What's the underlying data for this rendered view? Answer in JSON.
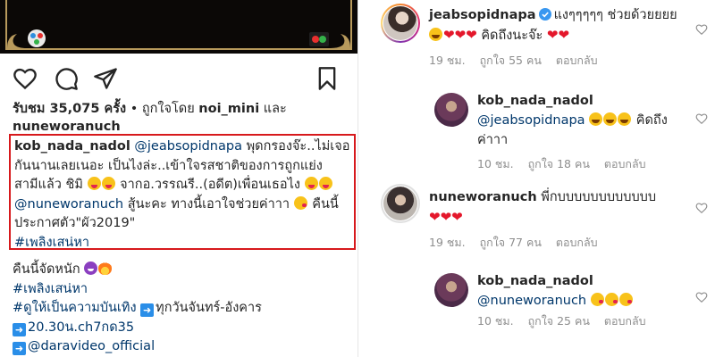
{
  "post": {
    "likes_prefix": "รับชม",
    "views_count": "35,075",
    "views_suffix": "ครั้ง",
    "liked_by_prefix": "• ถูกใจโดย",
    "liked_by_user": "noi_mini",
    "and_word": "และ",
    "liked_by_user2": "nuneworanuch",
    "caption": {
      "username": "kob_nada_nadol",
      "mention1": "@jeabsopidnapa",
      "line1_text": "พุดกรองจ๊ะ..ไม่เจอ",
      "line2": "กันนานเลยเนอะ เป็นไงล่ะ..เข้าใจรสชาติของการถูกแย่ง",
      "line3_text": "สามีแล้ว ชิมิ",
      "line3_after": "จากอ.วรรณรี..(อดีต)เพื่อนเธอไง",
      "mention2": "@nuneworanuch",
      "line4_text": "สู้นะคะ ทางนี้เอาใจช่วยค่าาา",
      "line4_after": "คืนนี้",
      "line5": "ประกาศตัว\"ผัว2019\"",
      "hashtag": "#เพลิงเสน่หา"
    },
    "extra": {
      "line1": "คืนนี้จัดหนัก",
      "hashtag": "#เพลิงเสน่หา",
      "line3_tag": "#ดูให้เป็นความบันเทิง",
      "line3_after": "ทุกวันจันทร์-อังคาร",
      "line4": "20.30น.ch7กด35",
      "line5": "@daravideo_official"
    }
  },
  "comments": [
    {
      "username": "jeabsopidnapa",
      "text_a": "แงๆๆๆๆๆ ช่วยด้วยยยย",
      "text_b": "คิดถึงนะจ๊ะ",
      "time": "19 ชม.",
      "likes": "ถูกใจ 55 คน",
      "reply": "ตอบกลับ"
    },
    {
      "username": "kob_nada_nadol",
      "mention": "@jeabsopidnapa",
      "text_b": "คิดถึง",
      "text_c": "ค่าาา",
      "time": "10 ชม.",
      "likes": "ถูกใจ 18 คน",
      "reply": "ตอบกลับ"
    },
    {
      "username": "nuneworanuch",
      "text_a": "พี่กบบบบบบบบบบบบ",
      "time": "19 ชม.",
      "likes": "ถูกใจ 77 คน",
      "reply": "ตอบกลับ"
    },
    {
      "username": "kob_nada_nadol",
      "mention": "@nuneworanuch",
      "time": "10 ชม.",
      "likes": "ถูกใจ 25 คน",
      "reply": "ตอบกลับ"
    }
  ],
  "colors": {
    "caption_border": "#d7191c",
    "link": "#00376b",
    "meta": "#8e8e8e",
    "verified": "#3897f0"
  }
}
